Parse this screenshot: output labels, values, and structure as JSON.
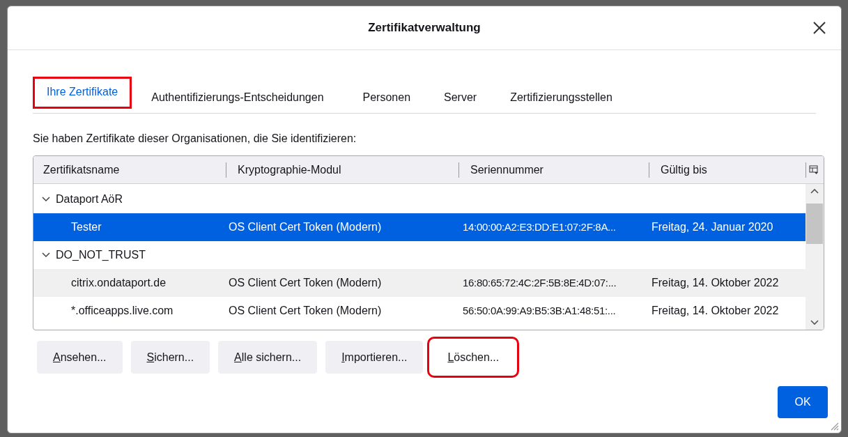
{
  "window": {
    "title": "Zertifikatverwaltung"
  },
  "tabs": [
    {
      "label": "Ihre Zertifikate",
      "selected": true,
      "highlighted": true
    },
    {
      "label": "Authentifizierungs-Entscheidungen",
      "selected": false,
      "highlighted": false
    },
    {
      "label": "Personen",
      "selected": false,
      "highlighted": false
    },
    {
      "label": "Server",
      "selected": false,
      "highlighted": false
    },
    {
      "label": "Zertifizierungsstellen",
      "selected": false,
      "highlighted": false
    }
  ],
  "description": "Sie haben Zertifikate dieser Organisationen, die Sie identifizieren:",
  "table": {
    "columns": [
      "Zertifikatsname",
      "Kryptographie-Modul",
      "Seriennummer",
      "Gültig bis"
    ],
    "rows": [
      {
        "label": "Dataport AöR",
        "expanded": true,
        "children": [
          {
            "cells": [
              "Tester",
              "OS Client Cert Token (Modern)",
              "14:00:00:A2:E3:DD:E1:07:2F:8A...",
              "Freitag, 24. Januar 2020"
            ],
            "selected": true
          }
        ]
      },
      {
        "label": "DO_NOT_TRUST",
        "expanded": true,
        "children": [
          {
            "cells": [
              "citrix.ondataport.de",
              "OS Client Cert Token (Modern)",
              "16:80:65:72:4C:2F:5B:8E:4D:07:...",
              "Freitag, 14. Oktober 2022"
            ],
            "selected": false
          },
          {
            "cells": [
              "*.officeapps.live.com",
              "OS Client Cert Token (Modern)",
              "56:50:0A:99:A9:B5:3B:A1:48:51:...",
              "Freitag, 14. Oktober 2022"
            ],
            "selected": false
          }
        ]
      }
    ]
  },
  "buttons": [
    {
      "label": "Ansehen...",
      "highlighted": false
    },
    {
      "label": "Sichern...",
      "highlighted": false
    },
    {
      "label": "Alle sichern...",
      "highlighted": false
    },
    {
      "label": "Importieren...",
      "highlighted": false
    },
    {
      "label": "Löschen...",
      "highlighted": true
    }
  ],
  "ok_button": "OK"
}
